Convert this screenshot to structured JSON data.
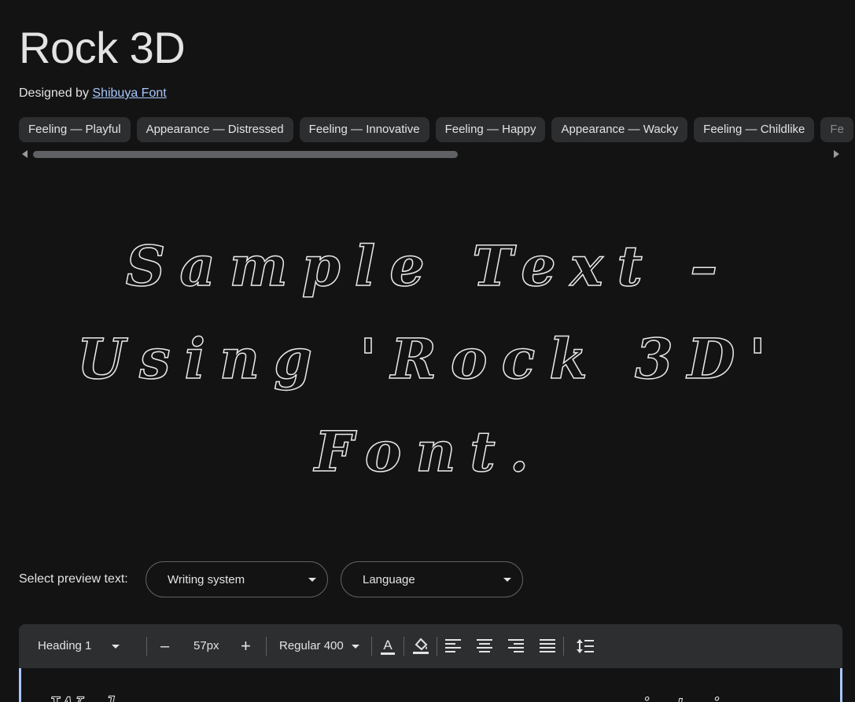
{
  "font": {
    "title": "Rock 3D",
    "designed_by_label": "Designed by",
    "designer_name": "Shibuya Font"
  },
  "tags": [
    "Feeling — Playful",
    "Appearance — Distressed",
    "Feeling — Innovative",
    "Feeling — Happy",
    "Appearance — Wacky",
    "Feeling — Childlike",
    "Fe"
  ],
  "sample": {
    "line1": "Sample Text –",
    "line2": "Using 'Rock 3D'",
    "line3": "Font."
  },
  "preview": {
    "label": "Select preview text:",
    "writing_system": "Writing system",
    "language": "Language"
  },
  "toolbar": {
    "style": "Heading 1",
    "decrease": "–",
    "size": "57px",
    "increase": "+",
    "weight": "Regular 400"
  },
  "editor": {
    "text": "Whereas recognition"
  },
  "colors": {
    "background": "#131314",
    "chip": "#2d2e30",
    "link": "#a8c7fa",
    "text": "#e3e3e3"
  }
}
